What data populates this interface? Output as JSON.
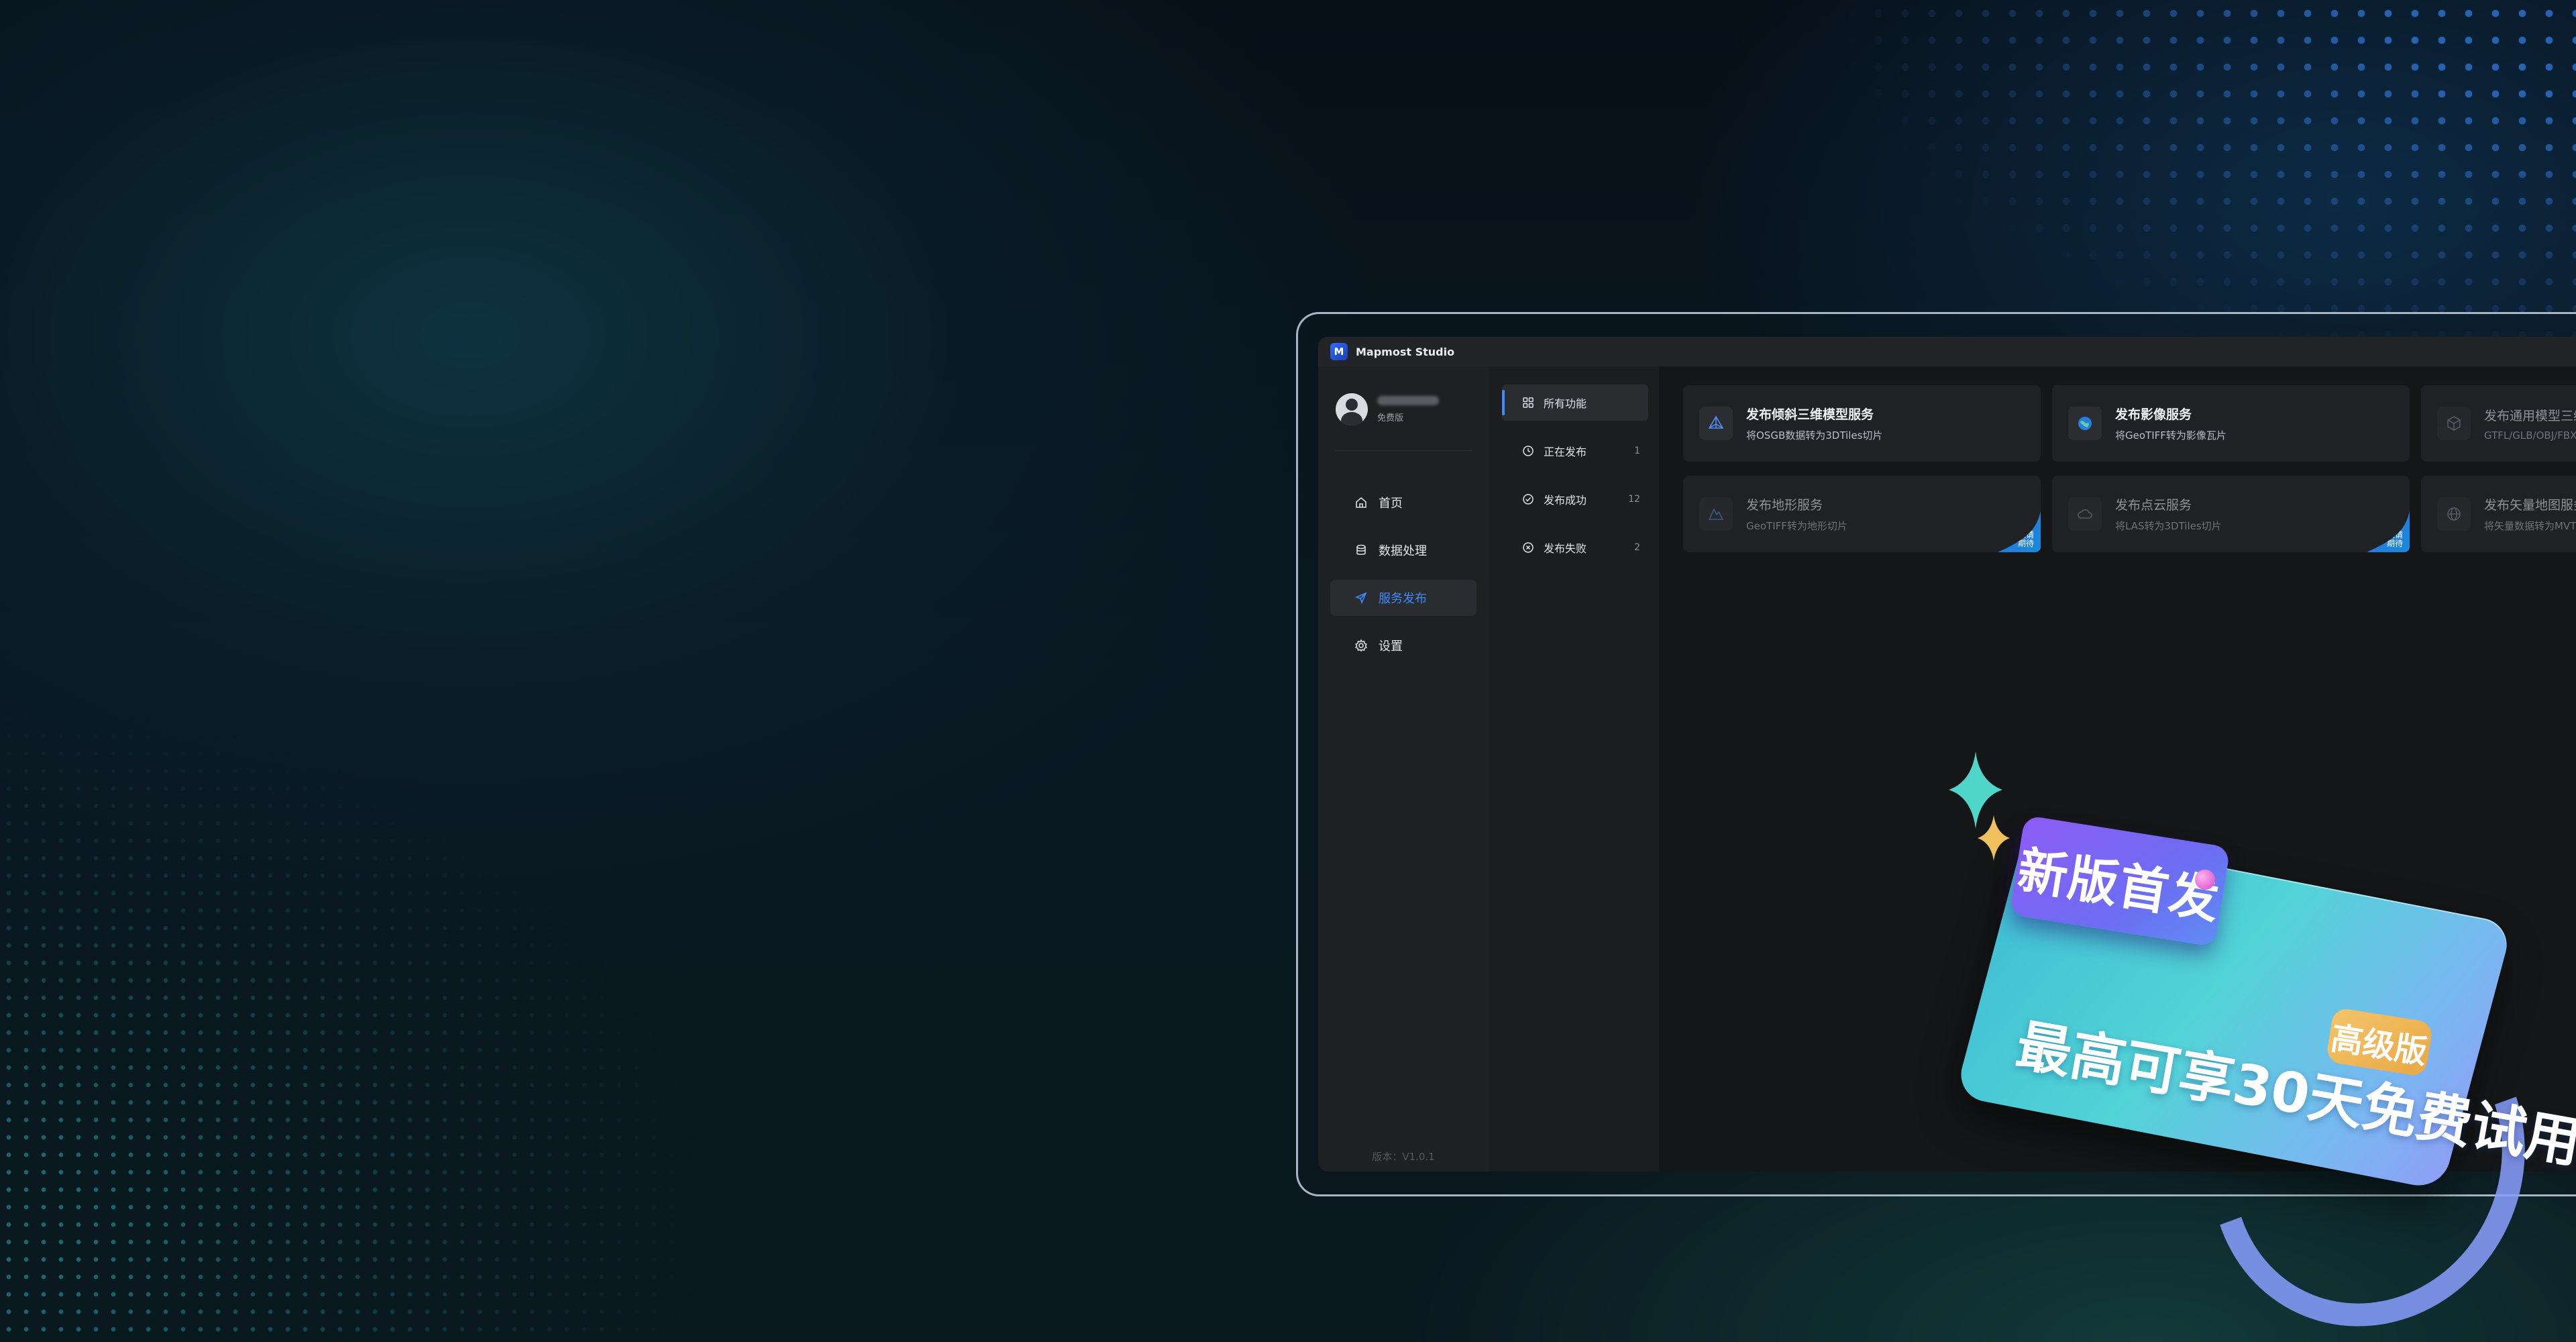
{
  "app": {
    "title": "Mapmost Studio",
    "logo_text": "M",
    "version": "版本：V1.0.1"
  },
  "user": {
    "tier": "免费版"
  },
  "nav": {
    "items": [
      {
        "label": "首页",
        "icon": "home-icon",
        "active": false
      },
      {
        "label": "数据处理",
        "icon": "database-icon",
        "active": false
      },
      {
        "label": "服务发布",
        "icon": "send-icon",
        "active": true
      },
      {
        "label": "设置",
        "icon": "gear-icon",
        "active": false
      }
    ]
  },
  "subnav": {
    "items": [
      {
        "label": "所有功能",
        "count": "",
        "icon": "grid-icon",
        "active": true
      },
      {
        "label": "正在发布",
        "count": "1",
        "icon": "clock-icon",
        "active": false
      },
      {
        "label": "发布成功",
        "count": "12",
        "icon": "check-circle-icon",
        "active": false
      },
      {
        "label": "发布失败",
        "count": "2",
        "icon": "x-circle-icon",
        "active": false
      }
    ]
  },
  "cards": [
    {
      "title": "发布倾斜三维模型服务",
      "desc": "将OSGB数据转为3DTiles切片",
      "icon": "pyramid-icon",
      "enabled": true
    },
    {
      "title": "发布影像服务",
      "desc": "将GeoTIFF转为影像瓦片",
      "icon": "globe-icon",
      "enabled": true
    },
    {
      "title": "发布通用模型三维",
      "desc": "GTFL/GLB/OBJ/FBX",
      "icon": "cube-icon",
      "enabled": false
    },
    {
      "title": "发布地形服务",
      "desc": "GeoTIFF转为地形切片",
      "icon": "terrain-icon",
      "enabled": false,
      "ribbon": "敬请期待"
    },
    {
      "title": "发布点云服务",
      "desc": "将LAS转为3DTiles切片",
      "icon": "cloud-icon",
      "enabled": false,
      "ribbon": "敬请期待"
    },
    {
      "title": "发布矢量地图服务",
      "desc": "将矢量数据转为MVT",
      "icon": "globe-icon",
      "enabled": false
    }
  ],
  "promo": {
    "tag": "新版首发",
    "headline": "最高可享30天免费试用",
    "badge": "高级版"
  },
  "colors": {
    "accent": "#3d8bff",
    "promo_cyan": "#52d3d6",
    "promo_purple": "#8d5cf6",
    "badge_gold": "#f3c56a"
  }
}
